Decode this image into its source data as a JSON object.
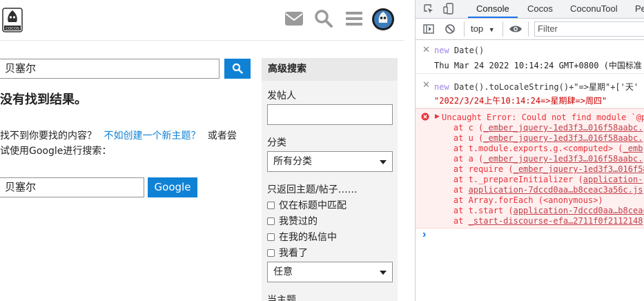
{
  "page": {
    "search": {
      "value": "贝塞尔"
    },
    "no_results": "没有找到结果。",
    "help_prefix": "找不到你要找的内容？",
    "help_link": "不如创建一个新主题？",
    "help_suffix": "或者尝",
    "help_line2": "试使用Google进行搜索：",
    "google_value": "贝塞尔",
    "google_button": "Google",
    "advanced": {
      "title": "高级搜索",
      "poster_label": "发帖人",
      "category_label": "分类",
      "category_value": "所有分类",
      "only_label": "只返回主题/帖子……",
      "checks": [
        "仅在标题中匹配",
        "我赞过的",
        "在我的私信中",
        "我看了"
      ],
      "any_value": "任意",
      "cut_label": "当主题"
    },
    "logo_text": "COCOS"
  },
  "devtools": {
    "tabs": [
      "Console",
      "Cocos",
      "CoconuTool",
      "Pe"
    ],
    "context": "top",
    "filter_placeholder": "Filter",
    "entries": [
      {
        "kw": "new",
        "cmd": " Date()",
        "result": "Thu Mar 24 2022 10:14:24 GMT+0800 (中国标准"
      },
      {
        "kw": "new",
        "cmd": " Date().toLocaleString()+\"=>星期\"+['天'",
        "result": "\"2022/3/24上午10:14:24=>星期肆=>周四\""
      }
    ],
    "error": {
      "head": "Uncaught Error: Could not find module `@p",
      "frames": [
        {
          "pre": "    at c (",
          "link": "_ember_jquery-1ed3f3…016f58aabc."
        },
        {
          "pre": "    at u (",
          "link": "_ember_jquery-1ed3f3…016f58aabc."
        },
        {
          "pre": "    at t.module.exports.g.<computed> (",
          "link": "_emb"
        },
        {
          "pre": "    at a (",
          "link": "_ember_jquery-1ed3f3…016f58aabc."
        },
        {
          "pre": "    at require (",
          "link": "_ember_jquery-1ed3f3…016f58"
        },
        {
          "pre": "    at t._prepareInitializer (",
          "link": "application-"
        },
        {
          "pre": "    at ",
          "link": "application-7dccd0aa…b8ceac3a56c.js"
        },
        {
          "pre": "    at Array.forEach (<anonymous>)",
          "link": ""
        },
        {
          "pre": "    at t.start (",
          "link": "application-7dccd0aa…b8ceac3"
        },
        {
          "pre": "    at ",
          "link": "_start-discourse-efa…2711f0f2112148"
        }
      ]
    },
    "prompt": "›"
  },
  "colors": {
    "accent": "#0f82d6",
    "error_bg": "#fff0f0",
    "error_text": "#e8333a"
  }
}
